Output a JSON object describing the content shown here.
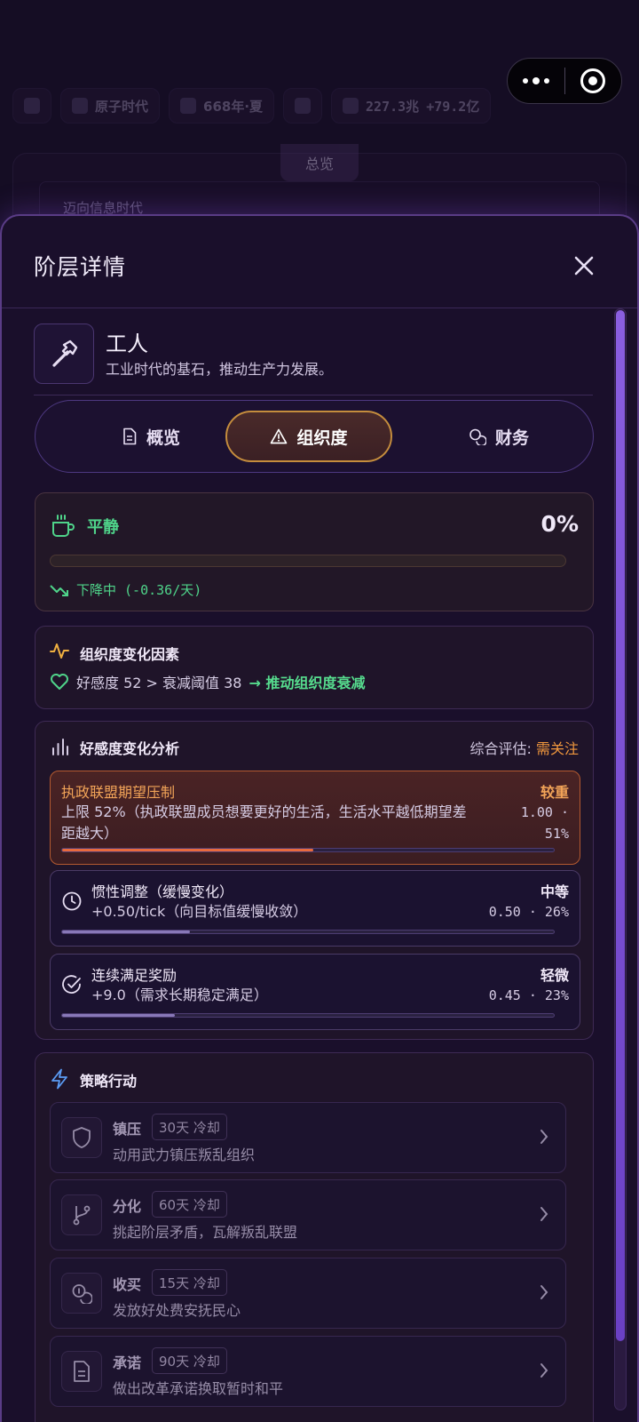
{
  "background": {
    "era": "原子时代",
    "date": "668年·夏",
    "money": "227.3兆",
    "money_delta": "+79.2亿",
    "tab": "总览",
    "banner": "迈向信息时代"
  },
  "modal": {
    "title": "阶层详情",
    "class_name": "工人",
    "class_desc": "工业时代的基石，推动生产力发展。",
    "tabs": [
      {
        "label": "概览",
        "icon": "document-icon"
      },
      {
        "label": "组织度",
        "icon": "warning-icon",
        "active": true
      },
      {
        "label": "财务",
        "icon": "coins-icon"
      }
    ]
  },
  "status": {
    "label": "平静",
    "icon": "coffee-cup-icon",
    "percent": "0%",
    "progress": 0,
    "trend": "下降中 (-0.36/天)"
  },
  "factors": {
    "title": "组织度变化因素",
    "line_prefix": "好感度 52 > 衰减阈值 38",
    "line_effect": "→ 推动组织度衰减"
  },
  "analysis": {
    "title": "好感度变化分析",
    "assess_label": "综合评估:",
    "assess_value": "需关注",
    "items": [
      {
        "name": "执政联盟期望压制",
        "desc": "上限 52%（执政联盟成员想要更好的生活，生活水平越低期望差距越大）",
        "severity": "较重",
        "value": "1.00 ·",
        "share": "51%",
        "fill": 0.51
      },
      {
        "name": "惯性调整（缓慢变化）",
        "desc": "+0.50/tick（向目标值缓慢收敛）",
        "severity": "中等",
        "value": "0.50 · 26%",
        "fill": 0.26
      },
      {
        "name": "连续满足奖励",
        "desc": "+9.0（需求长期稳定满足）",
        "severity": "轻微",
        "value": "0.45 · 23%",
        "fill": 0.23
      }
    ]
  },
  "actions": {
    "title": "策略行动",
    "items": [
      {
        "name": "镇压",
        "cooldown": "30天 冷却",
        "desc": "动用武力镇压叛乱组织",
        "icon": "shield-icon"
      },
      {
        "name": "分化",
        "cooldown": "60天 冷却",
        "desc": "挑起阶层矛盾，瓦解叛乱联盟",
        "icon": "git-branch-icon"
      },
      {
        "name": "收买",
        "cooldown": "15天 冷却",
        "desc": "发放好处费安抚民心",
        "icon": "coins-icon"
      },
      {
        "name": "承诺",
        "cooldown": "90天 冷却",
        "desc": "做出改革承诺换取暂时和平",
        "icon": "document-icon"
      }
    ]
  },
  "colors": {
    "accent": "#8a5ee0",
    "positive": "#4fd48a",
    "warning": "#f0973d",
    "active_tab_border": "#c58d3d"
  }
}
